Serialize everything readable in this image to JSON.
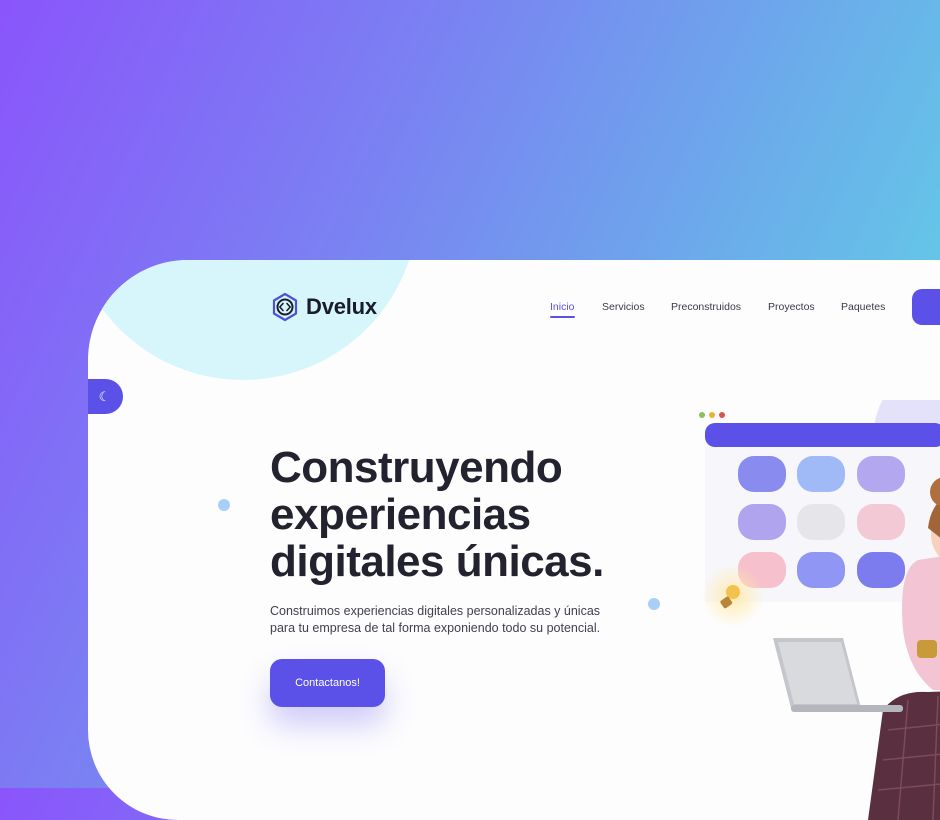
{
  "brand": {
    "name": "Dvelux",
    "accent": "#5b50e8"
  },
  "nav": {
    "items": [
      {
        "label": "Inicio",
        "active": true
      },
      {
        "label": "Servicios",
        "active": false
      },
      {
        "label": "Preconstruidos",
        "active": false
      },
      {
        "label": "Proyectos",
        "active": false
      },
      {
        "label": "Paquetes",
        "active": false
      }
    ]
  },
  "theme_toggle": {
    "icon": "moon-icon"
  },
  "hero": {
    "headline_lines": [
      "Construyendo",
      "experiencias",
      "digitales únicas."
    ],
    "subtitle_lines": [
      "Construimos experiencias digitales personalizadas y únicas",
      "para tu empresa de tal forma exponiendo todo su potencial."
    ],
    "cta_label": "Contactanos!"
  },
  "colors": {
    "background_gradient_start": "#8a55fb",
    "background_gradient_end": "#5ee0e4",
    "card_background": "#fdfdfe",
    "headline": "#23232f"
  }
}
